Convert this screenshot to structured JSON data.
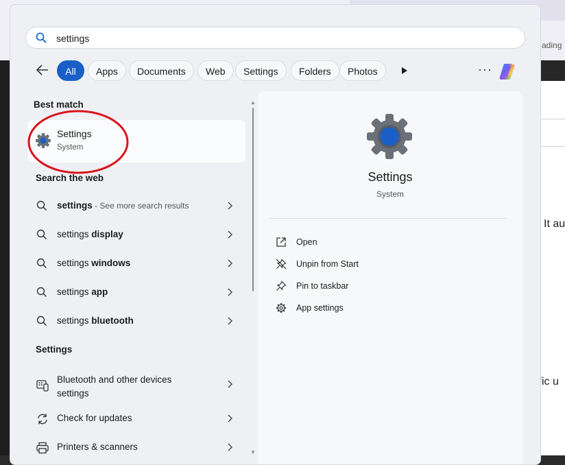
{
  "background": {
    "top_right_text": "ading",
    "right_text_1": "It au",
    "right_text_2": "cific u"
  },
  "search": {
    "query": "settings"
  },
  "filters": {
    "chips": [
      "All",
      "Apps",
      "Documents",
      "Web",
      "Settings",
      "Folders",
      "Photos"
    ],
    "active": "All",
    "more_label": "···"
  },
  "best_match": {
    "heading": "Best match",
    "name": "Settings",
    "type": "System"
  },
  "web": {
    "heading": "Search the web",
    "items": [
      {
        "bold": "settings",
        "normal": "",
        "meta": " - See more search results"
      },
      {
        "bold": "display",
        "normal": "settings ",
        "meta": ""
      },
      {
        "bold": "windows",
        "normal": "settings ",
        "meta": ""
      },
      {
        "bold": "app",
        "normal": "settings ",
        "meta": ""
      },
      {
        "bold": "bluetooth",
        "normal": "settings ",
        "meta": ""
      }
    ]
  },
  "settings_section": {
    "heading": "Settings",
    "items": [
      {
        "label": "Bluetooth and other devices settings",
        "icon": "bluetooth-devices-icon"
      },
      {
        "label": "Check for updates",
        "icon": "sync-icon"
      },
      {
        "label": "Printers & scanners",
        "icon": "printer-icon"
      }
    ]
  },
  "preview": {
    "title": "Settings",
    "subtitle": "System",
    "actions": [
      {
        "label": "Open",
        "icon": "open-external-icon"
      },
      {
        "label": "Unpin from Start",
        "icon": "unpin-icon"
      },
      {
        "label": "Pin to taskbar",
        "icon": "pin-icon"
      },
      {
        "label": "App settings",
        "icon": "gear-icon"
      }
    ]
  },
  "colors": {
    "accent": "#1a5fc7",
    "highlight_circle": "#d8141c"
  }
}
